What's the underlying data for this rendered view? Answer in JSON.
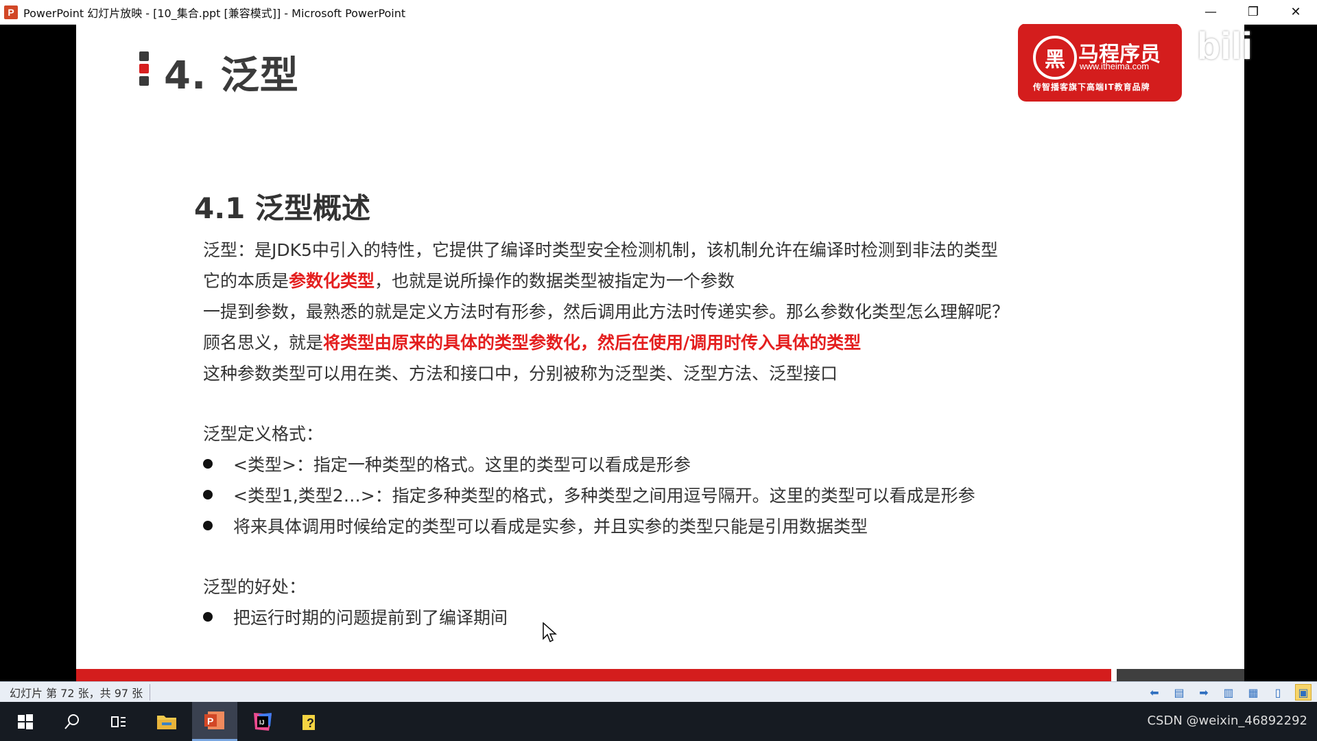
{
  "window": {
    "app_icon": "P",
    "title": "PowerPoint 幻灯片放映 - [10_集合.ppt [兼容模式]] - Microsoft PowerPoint",
    "minimize": "—",
    "restore": "❐",
    "close": "✕"
  },
  "slide": {
    "heading": "4. 泛型",
    "logo": {
      "symbol": "黑",
      "name": "马程序员",
      "url": "www.itheima.com",
      "slogan": "传智播客旗下高端IT教育品牌"
    },
    "watermark": "bili",
    "section_heading": "4.1 泛型概述",
    "paragraphs": {
      "p1": "泛型：是JDK5中引入的特性，它提供了编译时类型安全检测机制，该机制允许在编译时检测到非法的类型",
      "p2_before": "它的本质是",
      "p2_red": "参数化类型",
      "p2_after": "，也就是说所操作的数据类型被指定为一个参数",
      "p3": "一提到参数，最熟悉的就是定义方法时有形参，然后调用此方法时传递实参。那么参数化类型怎么理解呢？",
      "p4_before": "顾名思义，就是",
      "p4_red": "将类型由原来的具体的类型参数化，然后在使用/调用时传入具体的类型",
      "p5": "这种参数类型可以用在类、方法和接口中，分别被称为泛型类、泛型方法、泛型接口"
    },
    "format_label": "泛型定义格式：",
    "format_bullets": [
      "<类型>：指定一种类型的格式。这里的类型可以看成是形参",
      "<类型1,类型2…>：指定多种类型的格式，多种类型之间用逗号隔开。这里的类型可以看成是形参",
      "将来具体调用时候给定的类型可以看成是实参，并且实参的类型只能是引用数据类型"
    ],
    "benefit_label": "泛型的好处：",
    "benefit_bullets": [
      "把运行时期的问题提前到了编译期间"
    ]
  },
  "statusbar": {
    "slide_count": "幻灯片 第 72 张，共 97 张"
  },
  "taskbar": {
    "watermark_text": "CSDN @weixin_46892292"
  },
  "colors": {
    "accent_red": "#d41d1d",
    "text_red": "#e41f1f"
  }
}
